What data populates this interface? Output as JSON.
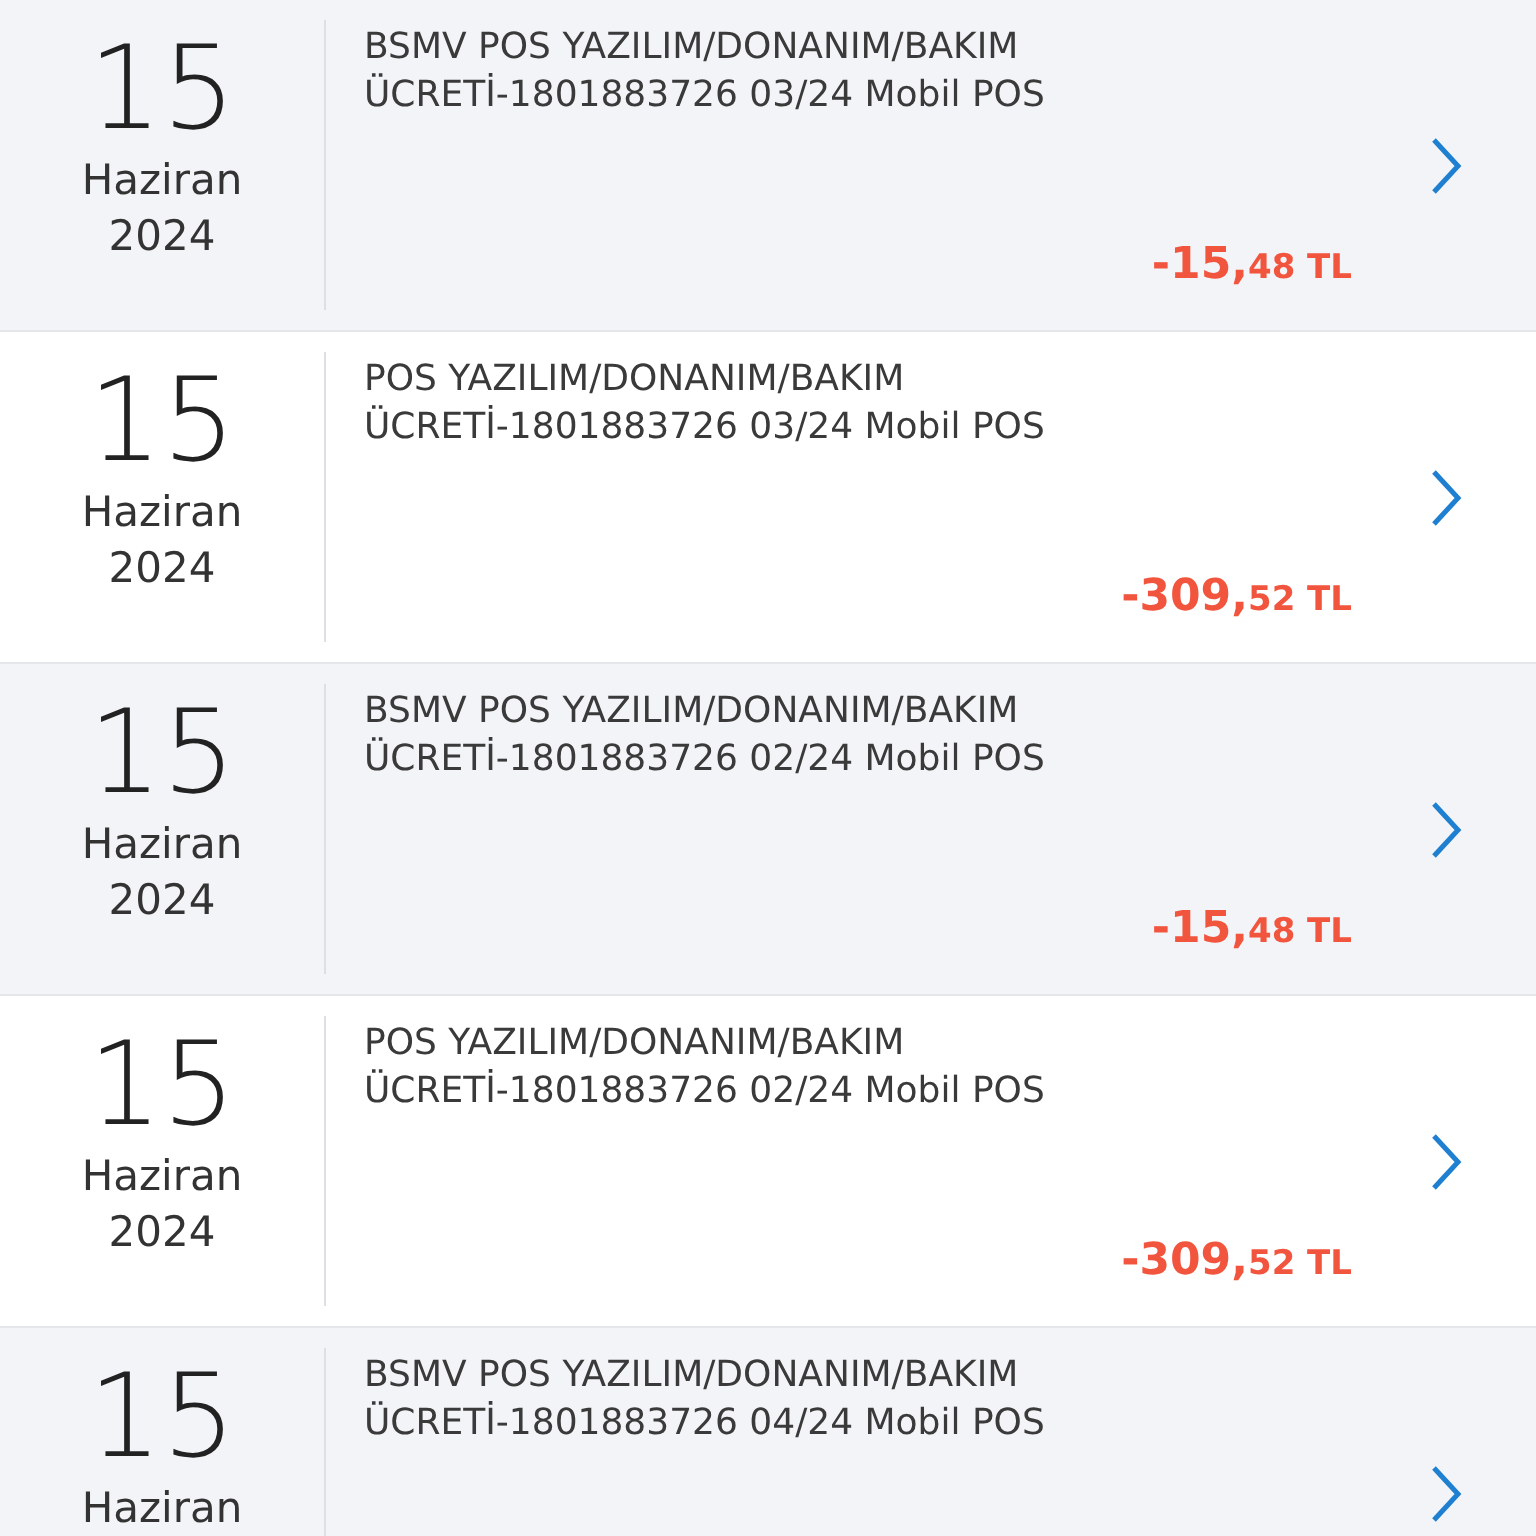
{
  "transactions": [
    {
      "day": "15",
      "month": "Haziran",
      "year": "2024",
      "description": "BSMV POS YAZILIM/DONANIM/BAKIM ÜCRETİ-1801883726 03/24 Mobil POS",
      "amount_whole": "-15,",
      "amount_cents": "48 TL",
      "shaded": true
    },
    {
      "day": "15",
      "month": "Haziran",
      "year": "2024",
      "description": "POS YAZILIM/DONANIM/BAKIM ÜCRETİ-1801883726 03/24 Mobil POS",
      "amount_whole": "-309,",
      "amount_cents": "52 TL",
      "shaded": false
    },
    {
      "day": "15",
      "month": "Haziran",
      "year": "2024",
      "description": "BSMV POS YAZILIM/DONANIM/BAKIM ÜCRETİ-1801883726 02/24 Mobil POS",
      "amount_whole": "-15,",
      "amount_cents": "48 TL",
      "shaded": true
    },
    {
      "day": "15",
      "month": "Haziran",
      "year": "2024",
      "description": "POS YAZILIM/DONANIM/BAKIM ÜCRETİ-1801883726 02/24 Mobil POS",
      "amount_whole": "-309,",
      "amount_cents": "52 TL",
      "shaded": false
    },
    {
      "day": "15",
      "month": "Haziran",
      "description": "BSMV POS YAZILIM/DONANIM/BAKIM ÜCRETİ-1801883726 04/24 Mobil POS",
      "shaded": true
    }
  ]
}
